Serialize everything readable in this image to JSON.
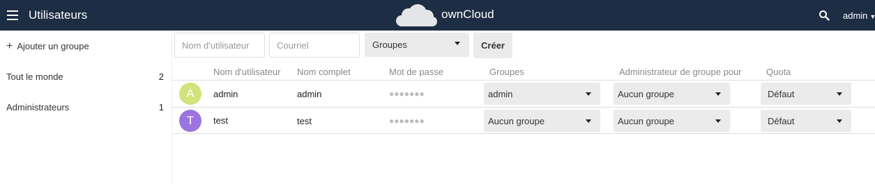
{
  "header": {
    "app_title": "Utilisateurs",
    "brand": "ownCloud",
    "user": "admin",
    "bg_color": "#1d2d44"
  },
  "sidebar": {
    "add_group": "Ajouter un groupe",
    "groups": [
      {
        "label": "Tout le monde",
        "count": "2"
      },
      {
        "label": "Administrateurs",
        "count": "1"
      }
    ]
  },
  "form": {
    "username_placeholder": "Nom d'utilisateur",
    "email_placeholder": "Courriel",
    "groups_label": "Groupes",
    "create_label": "Créer"
  },
  "table": {
    "headers": {
      "username": "Nom d'utilisateur",
      "fullname": "Nom complet",
      "password": "Mot de passe",
      "groups": "Groupes",
      "subadmin": "Administrateur de groupe pour",
      "quota": "Quota"
    },
    "rows": [
      {
        "initial": "A",
        "avatar_color": "#d2e27d",
        "username": "admin",
        "fullname": "admin",
        "password": "●●●●●●●",
        "groups": "admin",
        "subadmin": "Aucun groupe",
        "quota": "Défaut"
      },
      {
        "initial": "T",
        "avatar_color": "#9b74e0",
        "username": "test",
        "fullname": "test",
        "password": "●●●●●●●",
        "groups": "Aucun groupe",
        "subadmin": "Aucun groupe",
        "quota": "Défaut"
      }
    ]
  },
  "icons": {
    "menu": "hamburger-menu-icon",
    "logo": "owncloud-cloud-logo",
    "search": "search-icon",
    "add": "plus-icon",
    "dropdown": "caret-down-icon"
  }
}
